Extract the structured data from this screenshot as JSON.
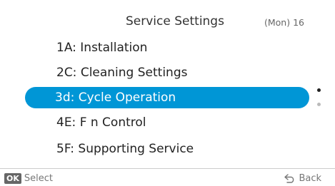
{
  "header": {
    "title": "Service Settings",
    "date": "(Mon) 16"
  },
  "menu": {
    "items": [
      {
        "label": "1A: Installation"
      },
      {
        "label": "2C: Cleaning Settings"
      },
      {
        "label": "3d: Cycle Operation",
        "selected": true
      },
      {
        "label": "4E: F  n Control"
      },
      {
        "label": "5F: Supporting Service"
      }
    ]
  },
  "scroll": {
    "current_page": 1,
    "total_pages": 2
  },
  "footer": {
    "ok_badge": "OK",
    "select_label": "Select",
    "back_label": "Back",
    "back_icon": "back-arrow-icon",
    "ok_icon": "ok-button-icon"
  },
  "colors": {
    "selection_background": "#0096d6",
    "selection_text": "#ffffff",
    "text": "#222222",
    "muted_text": "#777777",
    "ok_badge_background": "#666666"
  }
}
